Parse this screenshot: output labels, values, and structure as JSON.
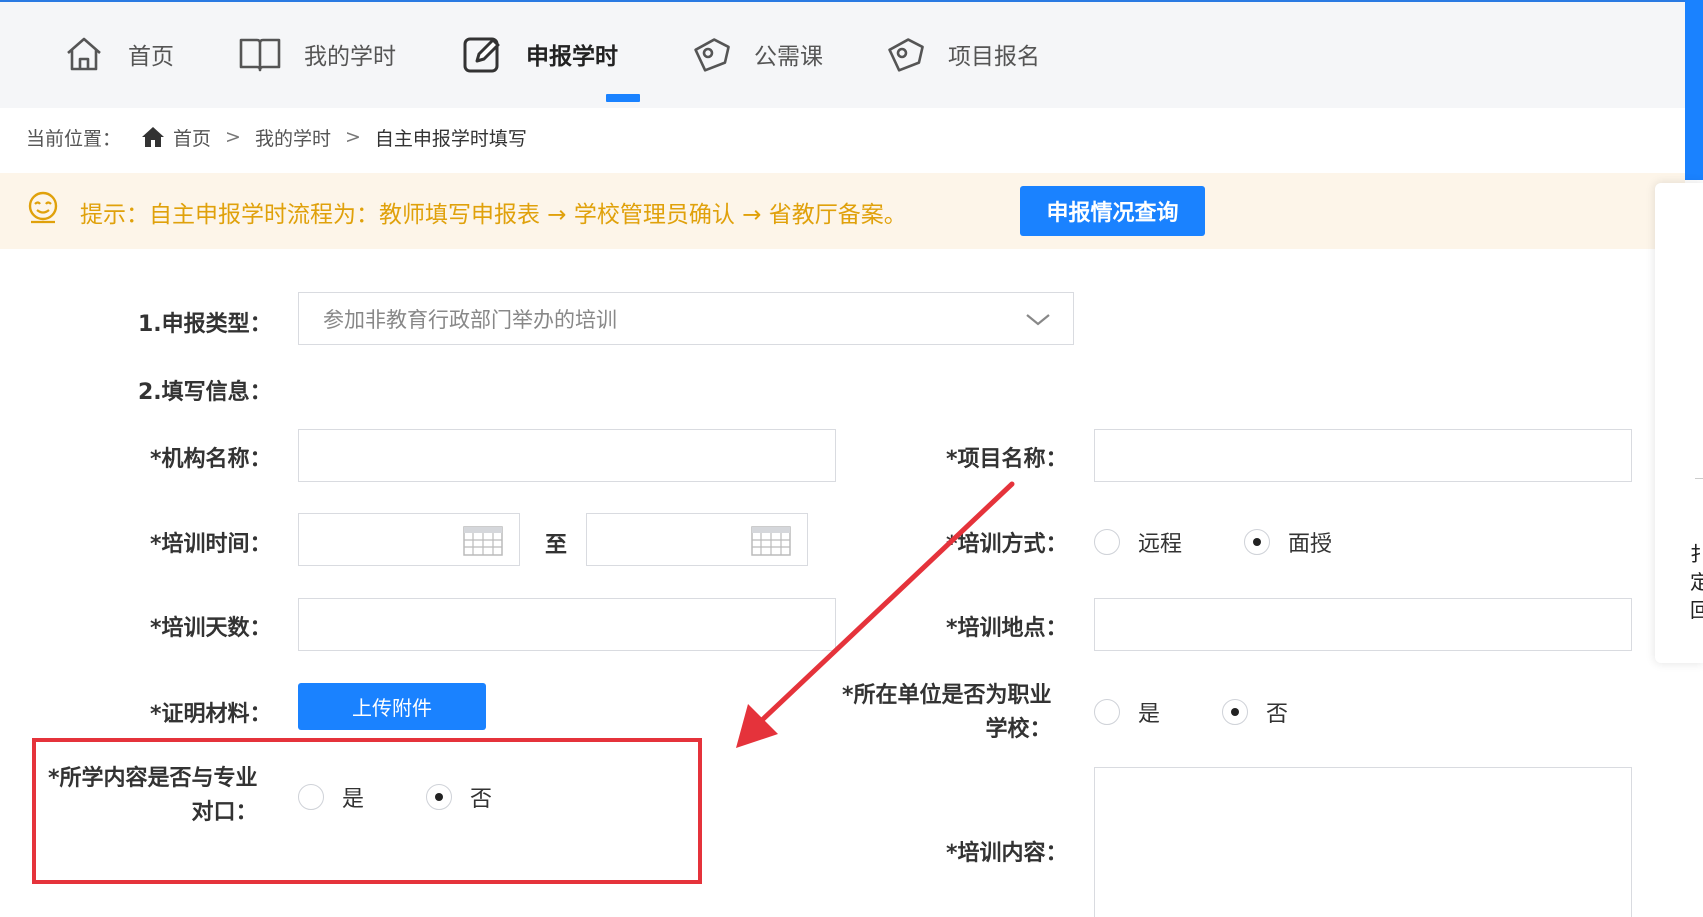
{
  "nav": {
    "items": [
      {
        "label": "首页",
        "icon": "home-icon"
      },
      {
        "label": "我的学时",
        "icon": "book-icon"
      },
      {
        "label": "申报学时",
        "icon": "edit-icon",
        "active": true
      },
      {
        "label": "公需课",
        "icon": "tag-icon"
      },
      {
        "label": "项目报名",
        "icon": "tag-icon"
      }
    ]
  },
  "breadcrumb": {
    "prefix": "当前位置：",
    "items": [
      "首页",
      "我的学时",
      "自主申报学时填写"
    ],
    "separator": ">"
  },
  "tip": {
    "text": "提示：自主申报学时流程为：教师填写申报表 → 学校管理员确认 → 省教厅备案。",
    "button_label": "申报情况查询"
  },
  "form": {
    "type_label": "1.申报类型：",
    "type_value": "参加非教育行政部门举办的培训",
    "info_label": "2.填写信息：",
    "org_name_label": "*机构名称：",
    "org_name_value": "",
    "project_name_label": "*项目名称：",
    "project_name_value": "",
    "train_time_label": "*培训时间：",
    "train_time_to": "至",
    "train_mode_label": "*培训方式：",
    "train_mode_options": [
      "远程",
      "面授"
    ],
    "train_mode_selected": "面授",
    "train_days_label": "*培训天数：",
    "train_place_label": "*培训地点：",
    "proof_label": "*证明材料：",
    "upload_label": "上传附件",
    "vocational_label_line1": "*所在单位是否为职业",
    "vocational_label_line2": "学校：",
    "vocational_options": [
      "是",
      "否"
    ],
    "vocational_selected": "否",
    "match_label_line1": "*所学内容是否与专业",
    "match_label_line2": "对口：",
    "match_options": [
      "是",
      "否"
    ],
    "match_selected": "否",
    "content_label": "*培训内容："
  },
  "side_panel": {
    "text_chars": [
      "扌",
      "定",
      "回"
    ]
  },
  "colors": {
    "accent": "#1a82ff",
    "tip_text": "#e0a10b",
    "tip_bg": "#fdf5e9",
    "highlight": "#e5333b"
  }
}
